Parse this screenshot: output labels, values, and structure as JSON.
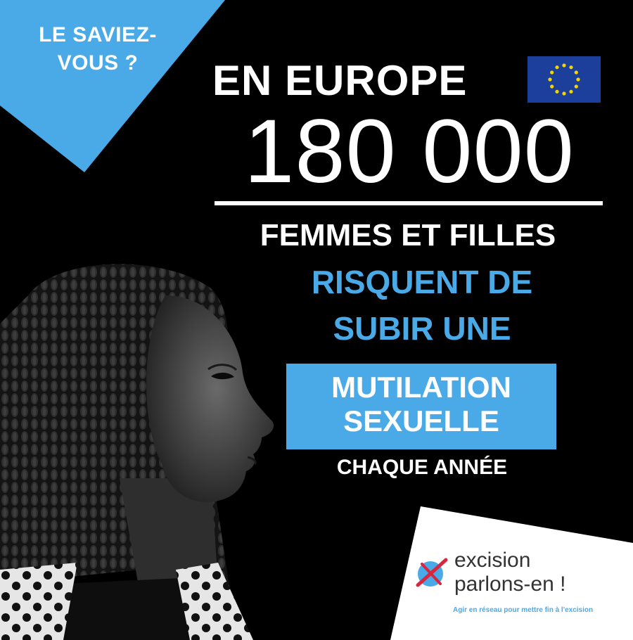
{
  "banner": {
    "line1": "LE SAVIEZ-",
    "line2": "VOUS ?"
  },
  "headline": {
    "title": "EN EUROPE",
    "number": "180 000",
    "line_white": "FEMMES ET FILLES",
    "line_blue_1": "RISQUENT DE",
    "line_blue_2": "SUBIR UNE",
    "box_line_1": "MUTILATION",
    "box_line_2": "SEXUELLE",
    "footer": "CHAQUE ANNÉE"
  },
  "logo": {
    "line1": "excision",
    "line2": "parlons-en !",
    "tagline": "Agir en réseau pour mettre fin à l'excision",
    "icon": "crossed-circle-icon"
  },
  "flag": {
    "icon": "eu-flag-icon"
  },
  "colors": {
    "background": "#000000",
    "accent_blue": "#4aaae8",
    "eu_blue": "#1d3f9c",
    "eu_gold": "#f5d400",
    "text_white": "#ffffff"
  }
}
